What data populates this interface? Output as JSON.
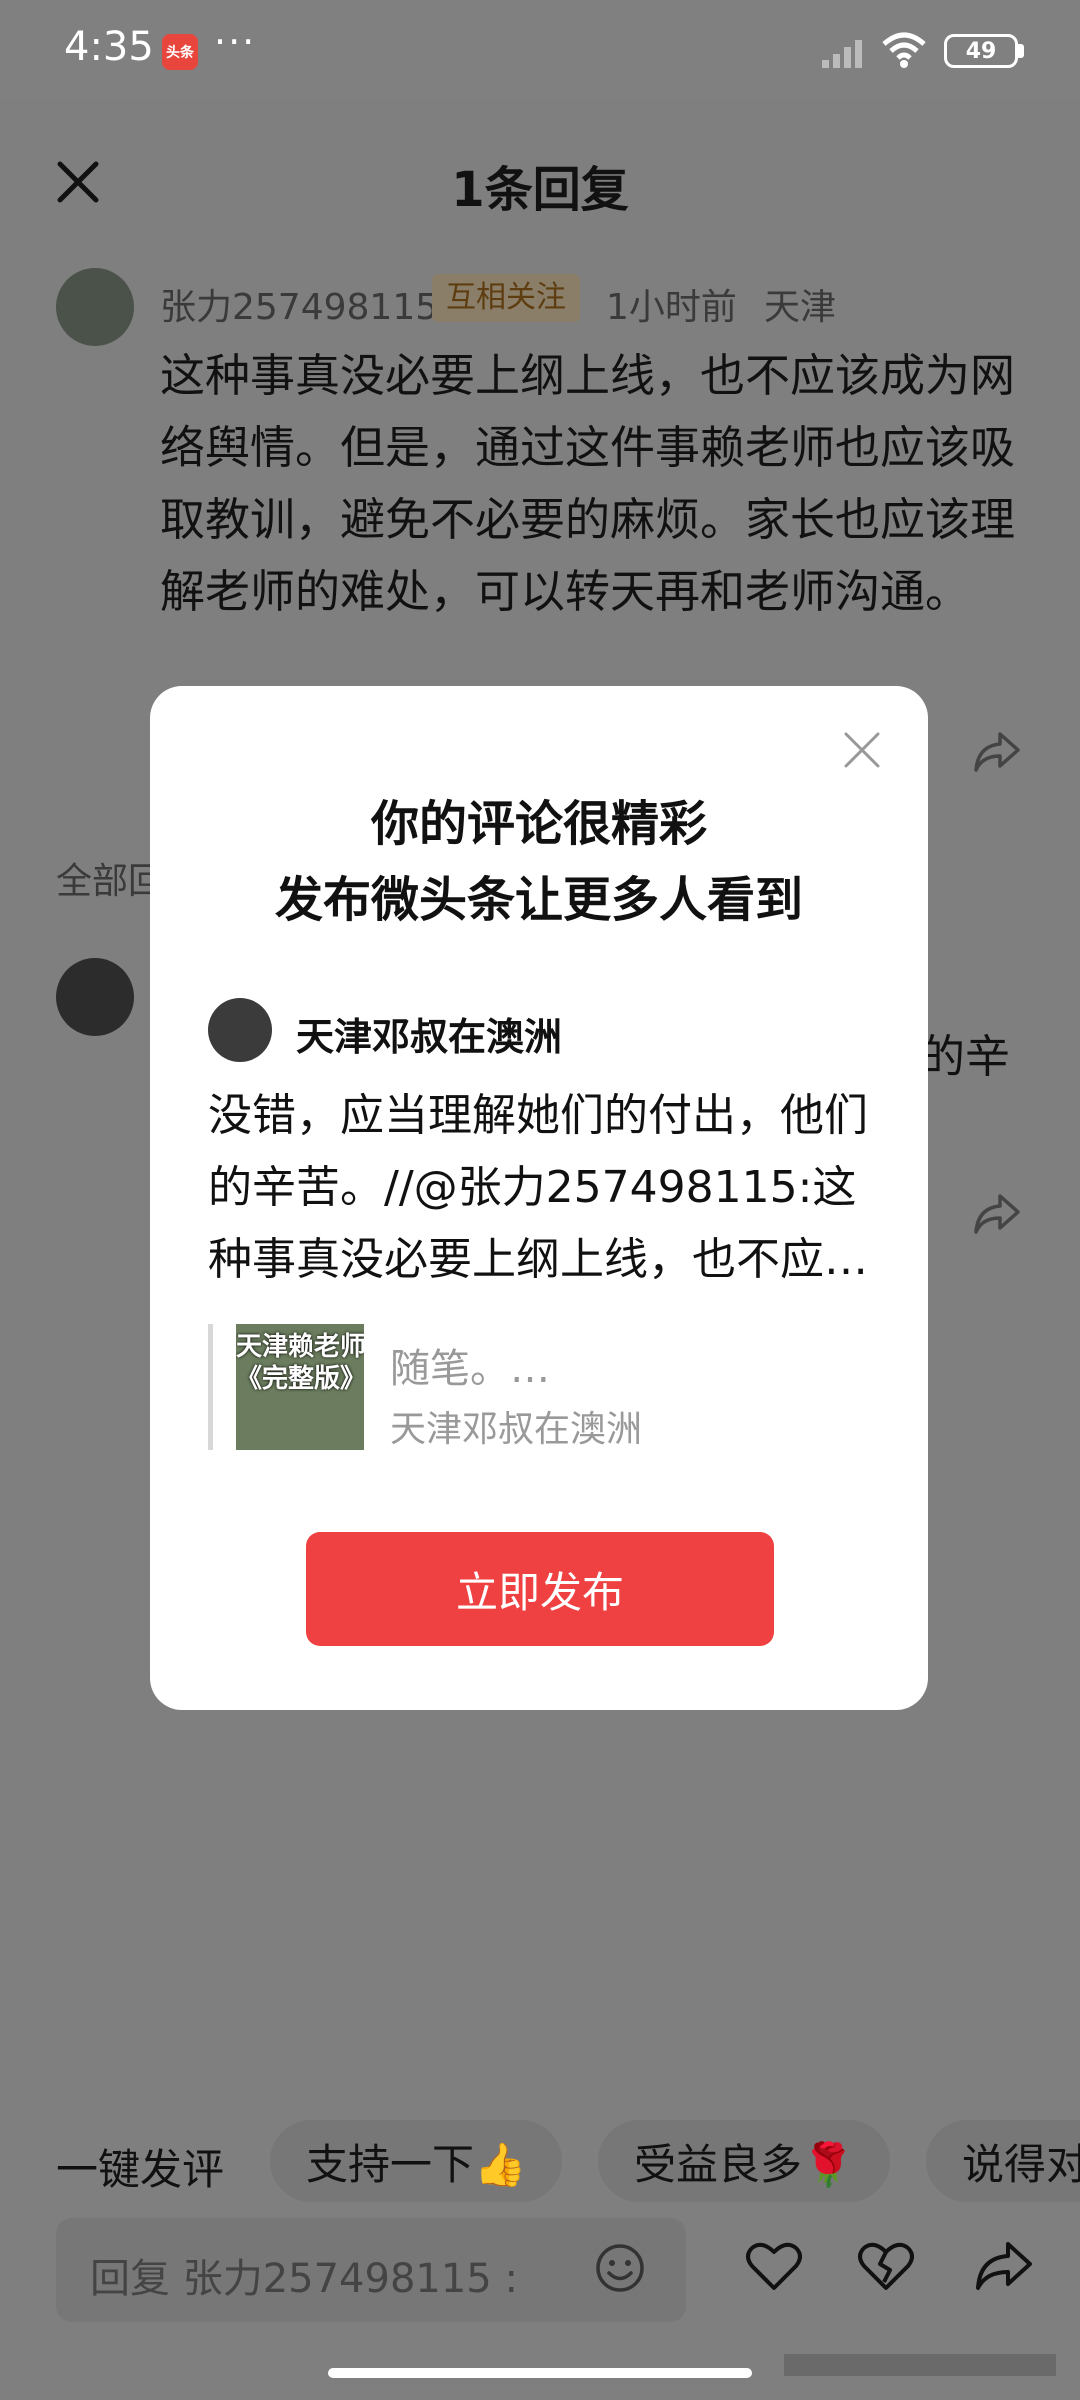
{
  "status_bar": {
    "time": "4:35",
    "app_badge": "头条",
    "more": "···",
    "battery": "49",
    "icons": [
      "signal-icon",
      "wifi-icon",
      "battery-icon"
    ]
  },
  "sheet": {
    "title": "1条回复"
  },
  "comment": {
    "username": "张力257498115",
    "tag": "互相关注",
    "time": "1小时前",
    "location": "天津",
    "text": "这种事真没必要上纲上线，也不应该成为网络舆情。但是，通过这件事赖老师也应该吸取教训，避免不必要的麻烦。家长也应该理解老师的难处，可以转天再和老师沟通。"
  },
  "all_replies_label": "全部回",
  "reply_partial": "的辛",
  "modal": {
    "title_line1": "你的评论很精彩",
    "title_line2": "发布微头条让更多人看到",
    "username": "天津邓叔在澳洲",
    "text": "没错，应当理解她们的付出，他们的辛苦。//@张力257498115:这种事真没必要上纲上线，也不应…",
    "quote": {
      "thumb_line1": "天津赖老师",
      "thumb_line2": "《完整版》",
      "title": "随笔。…",
      "author": "天津邓叔在澳洲"
    },
    "publish_label": "立即发布"
  },
  "quick_replies": {
    "label": "一键发评",
    "items": [
      "支持一下👍",
      "受益良多🌹",
      "说得对"
    ]
  },
  "reply_box": {
    "placeholder": "回复 张力257498115 :"
  }
}
